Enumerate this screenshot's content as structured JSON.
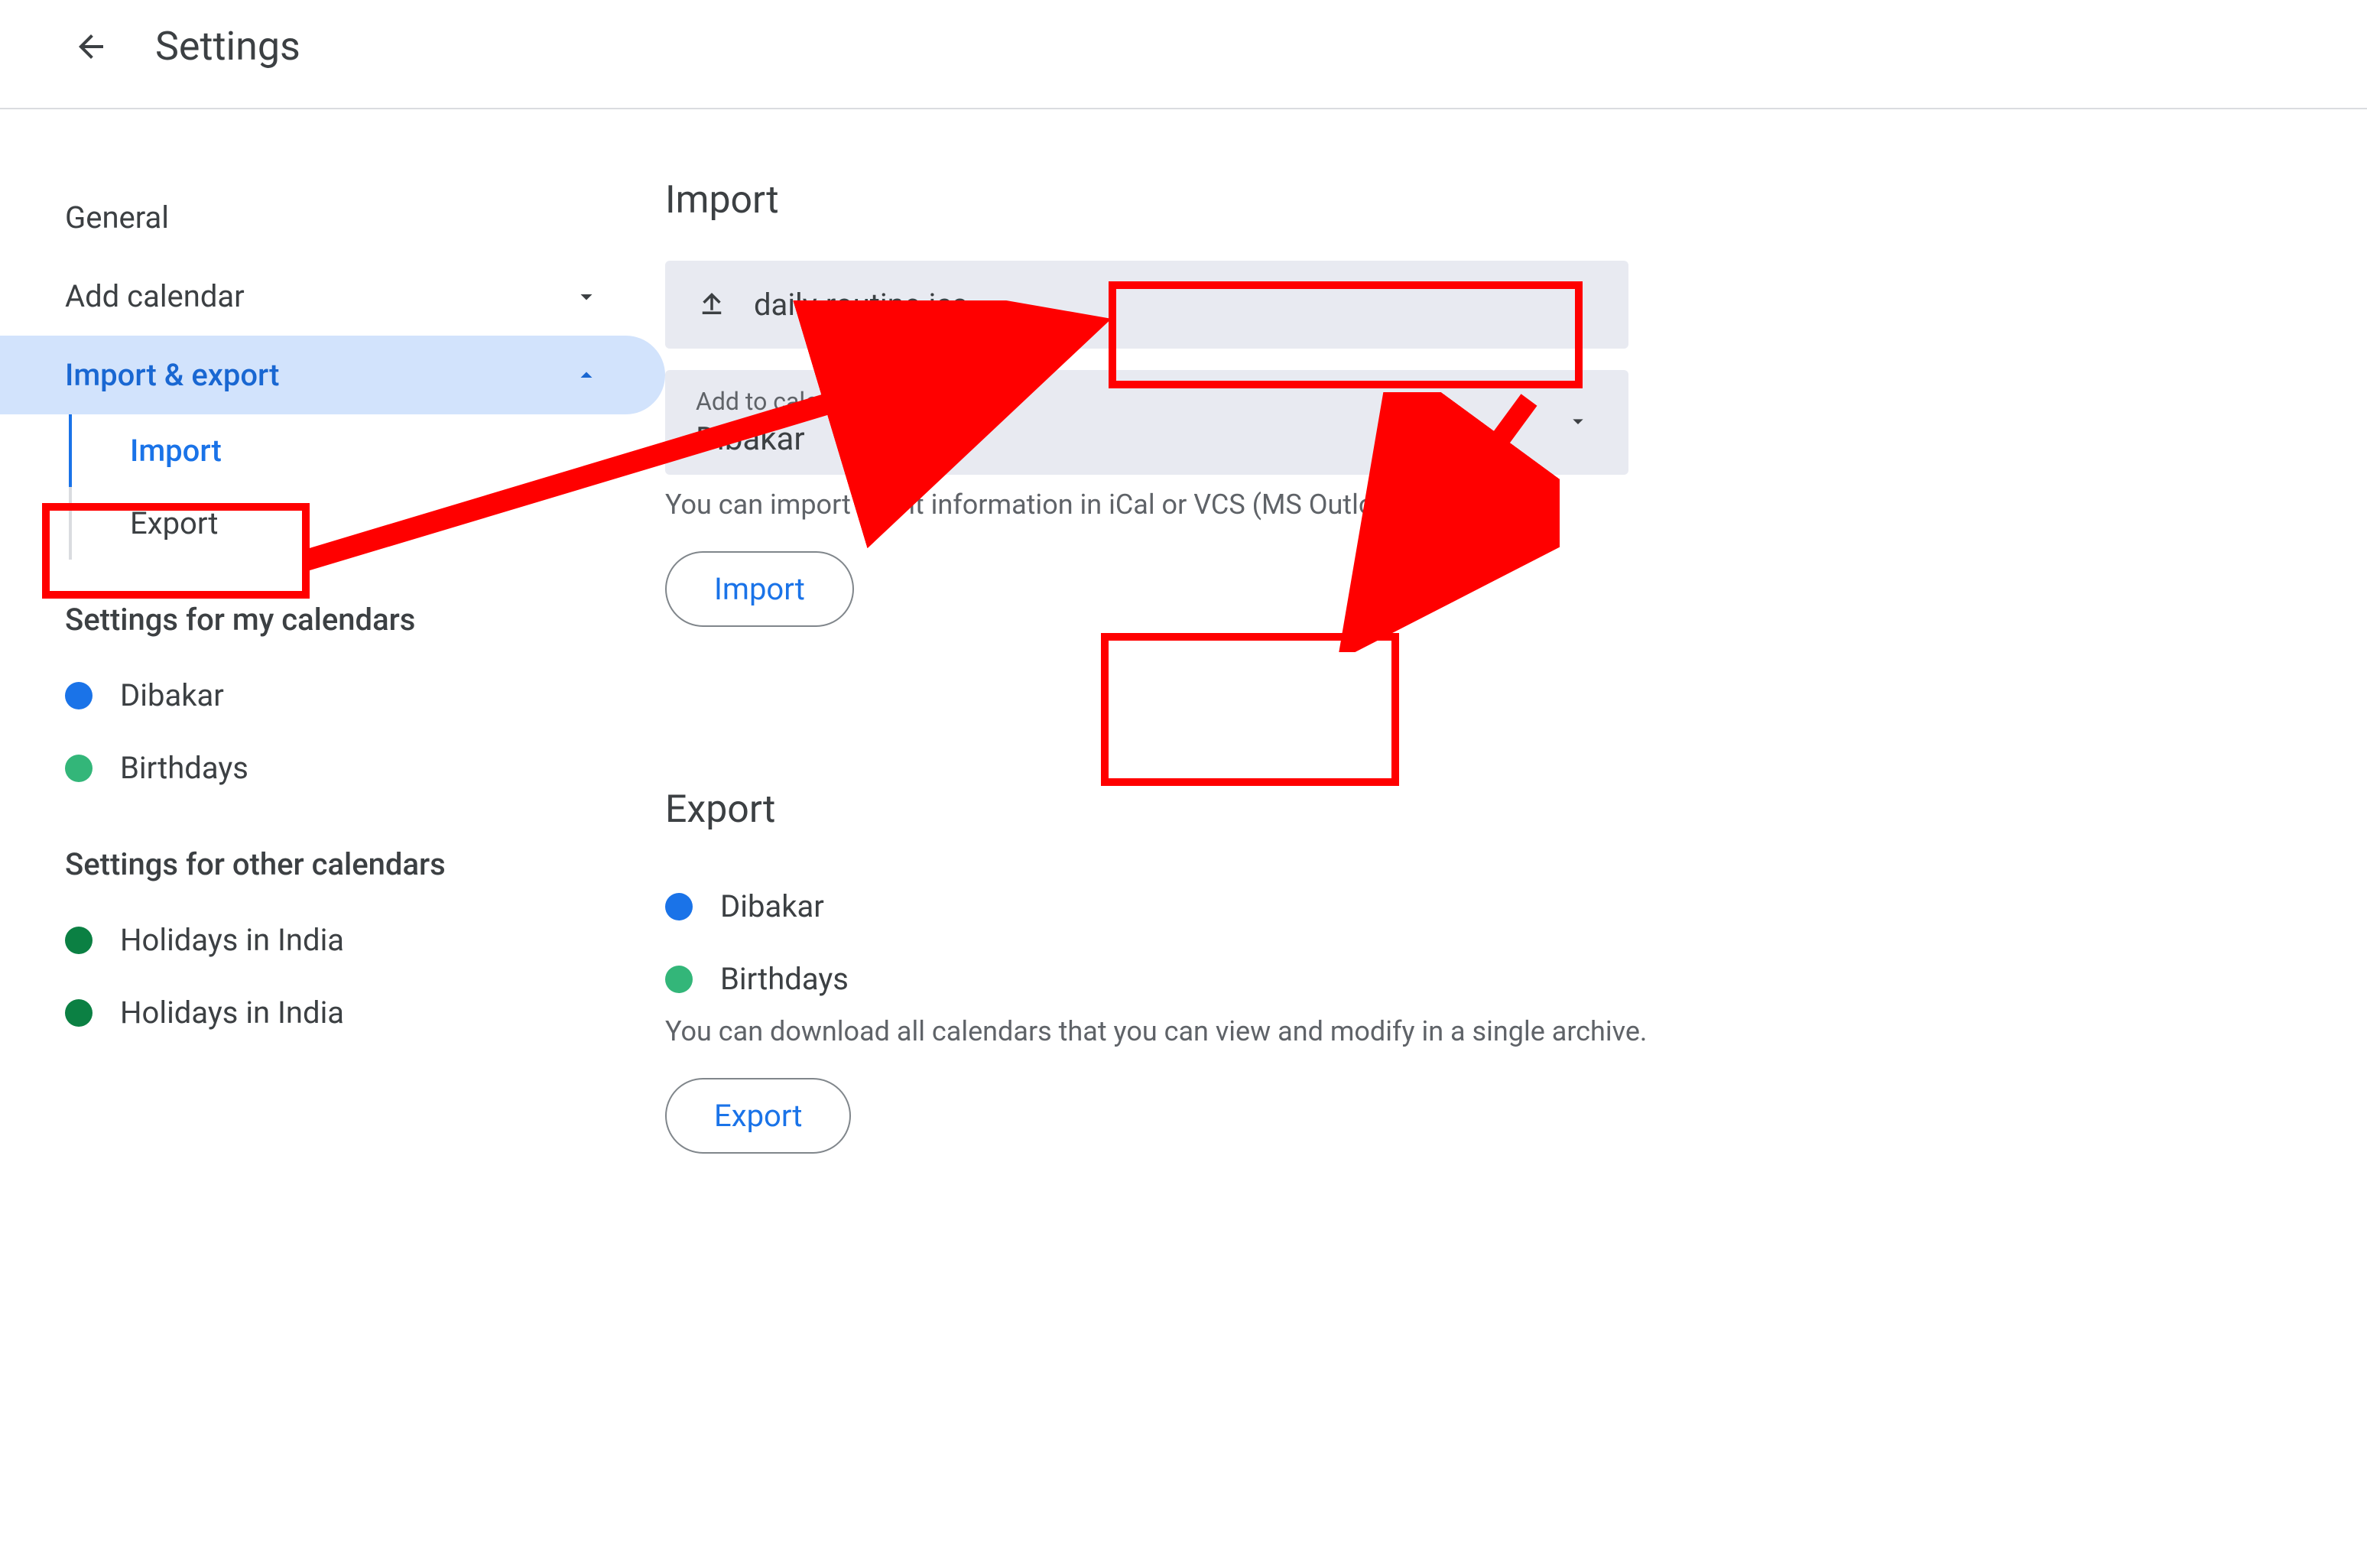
{
  "header": {
    "title": "Settings"
  },
  "sidebar": {
    "general": "General",
    "add_calendar": "Add calendar",
    "import_export": "Import & export",
    "import": "Import",
    "export": "Export",
    "settings_my": "Settings for my calendars",
    "my_calendars": [
      {
        "label": "Dibakar",
        "color": "#1a73e8"
      },
      {
        "label": "Birthdays",
        "color": "#33b679"
      }
    ],
    "settings_other": "Settings for other calendars",
    "other_calendars": [
      {
        "label": "Holidays in India",
        "color": "#0b8043"
      },
      {
        "label": "Holidays in India",
        "color": "#0b8043"
      }
    ]
  },
  "main": {
    "import": {
      "title": "Import",
      "file": "daily-routine.ics",
      "add_label": "Add to calendar",
      "add_value": "Dibakar",
      "hint": "You can import event information in iCal or VCS (MS Outlook) format.",
      "button": "Import"
    },
    "export": {
      "title": "Export",
      "calendars": [
        {
          "label": "Dibakar",
          "color": "#1a73e8"
        },
        {
          "label": "Birthdays",
          "color": "#33b679"
        }
      ],
      "hint": "You can download all calendars that you can view and modify in a single archive.",
      "button": "Export"
    }
  }
}
